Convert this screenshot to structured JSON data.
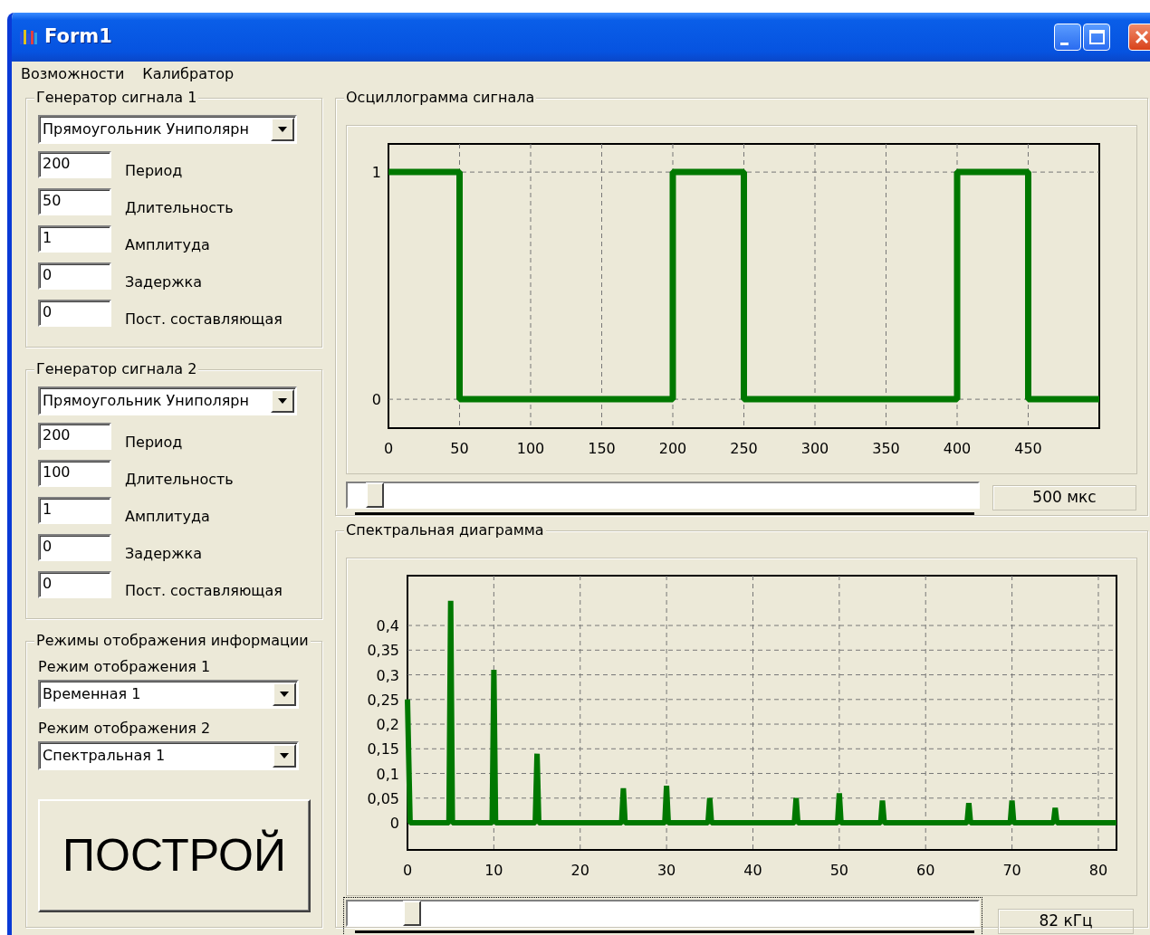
{
  "window": {
    "title": "Form1"
  },
  "menu": [
    "Возможности",
    "Калибратор"
  ],
  "generators": [
    {
      "title": "Генератор сигнала 1",
      "waveform": "Прямоугольник Униполярн",
      "fields": [
        {
          "value": "200",
          "label": "Период"
        },
        {
          "value": "50",
          "label": "Длительность"
        },
        {
          "value": "1",
          "label": "Амплитуда"
        },
        {
          "value": "0",
          "label": "Задержка"
        },
        {
          "value": "0",
          "label": "Пост. составляющая"
        }
      ]
    },
    {
      "title": "Генератор сигнала 2",
      "waveform": "Прямоугольник Униполярн",
      "fields": [
        {
          "value": "200",
          "label": "Период"
        },
        {
          "value": "100",
          "label": "Длительность"
        },
        {
          "value": "1",
          "label": "Амплитуда"
        },
        {
          "value": "0",
          "label": "Задержка"
        },
        {
          "value": "0",
          "label": "Пост. составляющая"
        }
      ]
    }
  ],
  "display_modes": {
    "title": "Режимы отображения информации",
    "modes": [
      {
        "label": "Режим отображения 1",
        "value": "Временная 1"
      },
      {
        "label": "Режим отображения 2",
        "value": "Спектральная 1"
      }
    ]
  },
  "build_button": "ПОСТРОЙ",
  "oscillogram": {
    "title": "Осциллограмма сигнала",
    "chart_data": {
      "type": "line",
      "x": [
        0,
        50,
        50,
        200,
        200,
        250,
        250,
        400,
        400,
        450,
        450,
        500
      ],
      "series": [
        {
          "color": "#007800",
          "values": [
            1,
            1,
            0,
            0,
            1,
            1,
            0,
            0,
            1,
            1,
            0,
            0
          ]
        }
      ],
      "grid": true,
      "xlim": [
        0,
        500
      ],
      "ylim": [
        -0.127,
        1.124
      ],
      "xticks": [
        0,
        50,
        100,
        150,
        200,
        250,
        300,
        350,
        400,
        450
      ],
      "yticks": [
        0,
        1
      ]
    },
    "slider": {
      "level": 0.03,
      "focused": false
    },
    "readout": "500 мкс"
  },
  "spectrum": {
    "title": "Спектральная диаграмма",
    "chart_data": {
      "type": "line",
      "x": [
        0,
        0.3,
        4.8,
        5,
        5.2,
        9.8,
        10,
        10.2,
        14.8,
        15,
        15.2,
        24.8,
        25,
        25.2,
        29.8,
        30,
        30.2,
        34.8,
        35,
        35.2,
        44.8,
        45,
        45.2,
        49.8,
        50,
        50.2,
        54.8,
        55,
        55.2,
        64.8,
        65,
        65.2,
        69.8,
        70,
        70.2,
        74.8,
        75,
        75.2,
        82.1
      ],
      "grid": true,
      "series": [
        {
          "color": "#007800",
          "values": [
            0.25,
            0,
            0,
            0.45,
            0,
            0,
            0.31,
            0,
            0,
            0.14,
            0,
            0,
            0.07,
            0,
            0,
            0.075,
            0,
            0,
            0.05,
            0,
            0,
            0.05,
            0,
            0,
            0.06,
            0,
            0,
            0.045,
            0,
            0,
            0.04,
            0,
            0,
            0.045,
            0,
            0,
            0.03,
            0,
            0
          ]
        }
      ],
      "xlim": [
        0,
        82.1
      ],
      "ylim": [
        -0.055,
        0.501
      ],
      "xticks": [
        0,
        10,
        20,
        30,
        40,
        50,
        60,
        70,
        80
      ],
      "yticks": [
        {
          "value": 0,
          "label": "0"
        },
        {
          "value": 0.05,
          "label": "0,05"
        },
        {
          "value": 0.1,
          "label": "0,1"
        },
        {
          "value": 0.15,
          "label": "0,15"
        },
        {
          "value": 0.2,
          "label": "0,2"
        },
        {
          "value": 0.25,
          "label": "0,25"
        },
        {
          "value": 0.3,
          "label": "0,3"
        },
        {
          "value": 0.35,
          "label": "0,35"
        },
        {
          "value": 0.4,
          "label": "0,4"
        }
      ]
    },
    "slider": {
      "level": 0.09,
      "focused": true
    },
    "readout": "82 кГц"
  }
}
